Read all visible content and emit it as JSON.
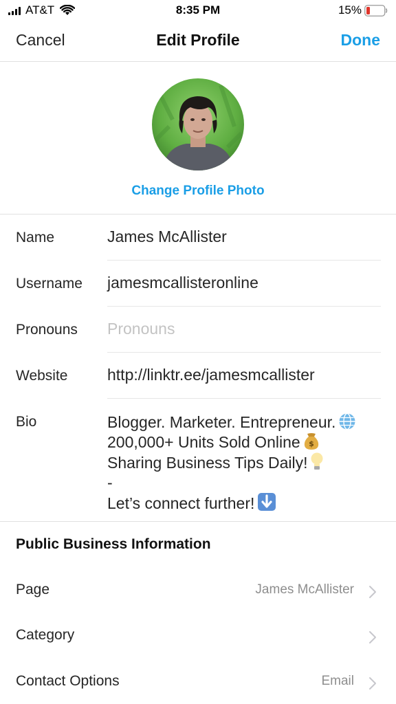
{
  "status_bar": {
    "carrier": "AT&T",
    "time": "8:35 PM",
    "battery": "15%"
  },
  "nav": {
    "cancel": "Cancel",
    "title": "Edit Profile",
    "done": "Done"
  },
  "profile_photo": {
    "change_label": "Change Profile Photo"
  },
  "fields": {
    "name": {
      "label": "Name",
      "value": "James McAllister"
    },
    "username": {
      "label": "Username",
      "value": "jamesmcallisteronline"
    },
    "pronouns": {
      "label": "Pronouns",
      "placeholder": "Pronouns"
    },
    "website": {
      "label": "Website",
      "value": "http://linktr.ee/jamesmcallister"
    },
    "bio": {
      "label": "Bio",
      "lines": [
        "Blogger. Marketer. Entrepreneur.",
        "200,000+ Units Sold Online",
        "Sharing Business Tips Daily!",
        "-",
        "Let’s connect further!"
      ],
      "emojis": [
        "globe-icon",
        "money-bag-icon",
        "light-bulb-icon",
        "down-arrow-icon"
      ]
    }
  },
  "business": {
    "heading": "Public Business Information",
    "page": {
      "label": "Page",
      "value": "James McAllister"
    },
    "category": {
      "label": "Category",
      "value": ""
    },
    "contact": {
      "label": "Contact Options",
      "value": "Email"
    }
  },
  "colors": {
    "accent": "#1a9ee6",
    "battery_low": "#e0352b",
    "placeholder": "#c3c3c3"
  }
}
